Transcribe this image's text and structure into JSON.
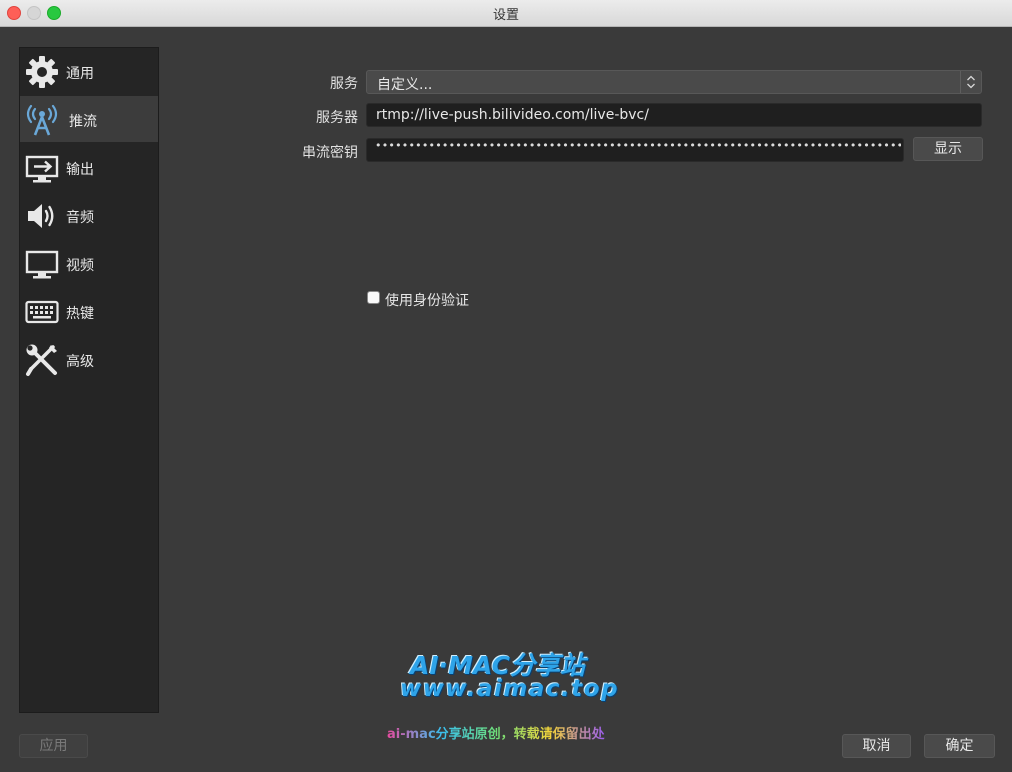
{
  "window": {
    "title": "设置"
  },
  "sidebar": {
    "items": [
      {
        "label": "通用",
        "icon": "gear-icon"
      },
      {
        "label": "推流",
        "icon": "broadcast-antenna-icon",
        "active": true
      },
      {
        "label": "输出",
        "icon": "output-monitor-icon"
      },
      {
        "label": "音频",
        "icon": "speaker-icon"
      },
      {
        "label": "视频",
        "icon": "monitor-icon"
      },
      {
        "label": "热键",
        "icon": "keyboard-icon"
      },
      {
        "label": "高级",
        "icon": "wrench-screwdriver-icon"
      }
    ]
  },
  "stream": {
    "service_label": "服务",
    "service_value": "自定义...",
    "server_label": "服务器",
    "server_value": "rtmp://live-push.bilivideo.com/live-bvc/",
    "key_label": "串流密钥",
    "key_masked": "••••••••••••••••••••••••••••••••••••••••••••••••••••••••••••••••••••••••••••••••••••••••••••••••••••••••",
    "show_button": "显示",
    "auth_label": "使用身份验证",
    "auth_checked": false
  },
  "footer": {
    "apply": "应用",
    "cancel": "取消",
    "ok": "确定"
  },
  "watermark": {
    "line1": "AI·MAC分享站",
    "line2": "www.aimac.top",
    "line3": "ai-mac分享站原创，转载请保留出处"
  },
  "colors": {
    "background": "#3a3a3a",
    "sidebar": "#252525",
    "sidebar_active": "#3c3c3c",
    "watermark_blue": "#2ea3e8"
  }
}
